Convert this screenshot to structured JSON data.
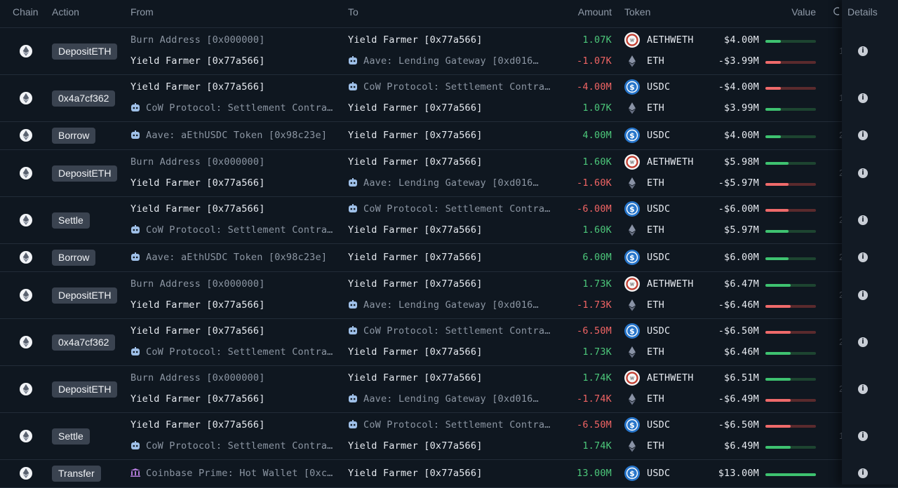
{
  "header": {
    "chain": "Chain",
    "action": "Action",
    "from": "From",
    "to": "To",
    "amount": "Amount",
    "token": "Token",
    "value": "Value",
    "details": "Details"
  },
  "colors": {
    "positive": "#4cc77a",
    "negative": "#f06464",
    "badge": "#3a4350"
  },
  "icons": {
    "chain": "ethereum-icon",
    "bot": "robot-icon",
    "bank": "bank-icon",
    "info": "info-icon",
    "clock": "clock-icon",
    "tokens": {
      "AETHWETH": "aethweth-token-icon",
      "ETH": "eth-token-icon",
      "USDC": "usdc-token-icon"
    }
  },
  "rows": [
    {
      "action": "DepositETH",
      "time_cut": "1",
      "lines": [
        {
          "from": "Burn Address [0x000000]",
          "from_style": "muted",
          "to": "Yield Farmer [0x77a566]",
          "to_style": "bright",
          "amount": "1.07K",
          "sign": "pos",
          "token": "AETHWETH",
          "usd": "$4.00M",
          "bar": 0.3
        },
        {
          "from": "Yield Farmer [0x77a566]",
          "from_style": "bright",
          "to": "Aave: Lending Gateway [0xd016…",
          "to_style": "muted",
          "to_icon": "bot",
          "amount": "-1.07K",
          "sign": "neg",
          "token": "ETH",
          "usd": "-$3.99M",
          "bar": 0.3
        }
      ]
    },
    {
      "action": "0x4a7cf362",
      "time_cut": "1",
      "lines": [
        {
          "from": "Yield Farmer [0x77a566]",
          "from_style": "bright",
          "to": "CoW Protocol: Settlement Contra…",
          "to_style": "muted",
          "to_icon": "bot",
          "amount": "-4.00M",
          "sign": "neg",
          "token": "USDC",
          "usd": "-$4.00M",
          "bar": 0.3
        },
        {
          "from": "CoW Protocol: Settlement Contra…",
          "from_style": "muted",
          "from_icon": "bot",
          "to": "Yield Farmer [0x77a566]",
          "to_style": "bright",
          "amount": "1.07K",
          "sign": "pos",
          "token": "ETH",
          "usd": "$3.99M",
          "bar": 0.3
        }
      ]
    },
    {
      "action": "Borrow",
      "time_cut": "2",
      "lines": [
        {
          "from": "Aave: aEthUSDC Token [0x98c23e]",
          "from_style": "muted",
          "from_icon": "bot",
          "to": "Yield Farmer [0x77a566]",
          "to_style": "bright",
          "amount": "4.00M",
          "sign": "pos",
          "token": "USDC",
          "usd": "$4.00M",
          "bar": 0.3
        }
      ]
    },
    {
      "action": "DepositETH",
      "time_cut": "2",
      "lines": [
        {
          "from": "Burn Address [0x000000]",
          "from_style": "muted",
          "to": "Yield Farmer [0x77a566]",
          "to_style": "bright",
          "amount": "1.60K",
          "sign": "pos",
          "token": "AETHWETH",
          "usd": "$5.98M",
          "bar": 0.46
        },
        {
          "from": "Yield Farmer [0x77a566]",
          "from_style": "bright",
          "to": "Aave: Lending Gateway [0xd016…",
          "to_style": "muted",
          "to_icon": "bot",
          "amount": "-1.60K",
          "sign": "neg",
          "token": "ETH",
          "usd": "-$5.97M",
          "bar": 0.46
        }
      ]
    },
    {
      "action": "Settle",
      "time_cut": "2",
      "lines": [
        {
          "from": "Yield Farmer [0x77a566]",
          "from_style": "bright",
          "to": "CoW Protocol: Settlement Contra…",
          "to_style": "muted",
          "to_icon": "bot",
          "amount": "-6.00M",
          "sign": "neg",
          "token": "USDC",
          "usd": "-$6.00M",
          "bar": 0.46
        },
        {
          "from": "CoW Protocol: Settlement Contra…",
          "from_style": "muted",
          "from_icon": "bot",
          "to": "Yield Farmer [0x77a566]",
          "to_style": "bright",
          "amount": "1.60K",
          "sign": "pos",
          "token": "ETH",
          "usd": "$5.97M",
          "bar": 0.46
        }
      ]
    },
    {
      "action": "Borrow",
      "time_cut": "2",
      "lines": [
        {
          "from": "Aave: aEthUSDC Token [0x98c23e]",
          "from_style": "muted",
          "from_icon": "bot",
          "to": "Yield Farmer [0x77a566]",
          "to_style": "bright",
          "amount": "6.00M",
          "sign": "pos",
          "token": "USDC",
          "usd": "$6.00M",
          "bar": 0.46
        }
      ]
    },
    {
      "action": "DepositETH",
      "time_cut": "2",
      "lines": [
        {
          "from": "Burn Address [0x000000]",
          "from_style": "muted",
          "to": "Yield Farmer [0x77a566]",
          "to_style": "bright",
          "amount": "1.73K",
          "sign": "pos",
          "token": "AETHWETH",
          "usd": "$6.47M",
          "bar": 0.5
        },
        {
          "from": "Yield Farmer [0x77a566]",
          "from_style": "bright",
          "to": "Aave: Lending Gateway [0xd016…",
          "to_style": "muted",
          "to_icon": "bot",
          "amount": "-1.73K",
          "sign": "neg",
          "token": "ETH",
          "usd": "-$6.46M",
          "bar": 0.5
        }
      ]
    },
    {
      "action": "0x4a7cf362",
      "time_cut": "2",
      "lines": [
        {
          "from": "Yield Farmer [0x77a566]",
          "from_style": "bright",
          "to": "CoW Protocol: Settlement Contra…",
          "to_style": "muted",
          "to_icon": "bot",
          "amount": "-6.50M",
          "sign": "neg",
          "token": "USDC",
          "usd": "-$6.50M",
          "bar": 0.5
        },
        {
          "from": "CoW Protocol: Settlement Contra…",
          "from_style": "muted",
          "from_icon": "bot",
          "to": "Yield Farmer [0x77a566]",
          "to_style": "bright",
          "amount": "1.73K",
          "sign": "pos",
          "token": "ETH",
          "usd": "$6.46M",
          "bar": 0.5
        }
      ]
    },
    {
      "action": "DepositETH",
      "time_cut": "2",
      "lines": [
        {
          "from": "Burn Address [0x000000]",
          "from_style": "muted",
          "to": "Yield Farmer [0x77a566]",
          "to_style": "bright",
          "amount": "1.74K",
          "sign": "pos",
          "token": "AETHWETH",
          "usd": "$6.51M",
          "bar": 0.5
        },
        {
          "from": "Yield Farmer [0x77a566]",
          "from_style": "bright",
          "to": "Aave: Lending Gateway [0xd016…",
          "to_style": "muted",
          "to_icon": "bot",
          "amount": "-1.74K",
          "sign": "neg",
          "token": "ETH",
          "usd": "-$6.49M",
          "bar": 0.5
        }
      ]
    },
    {
      "action": "Settle",
      "time_cut": "1",
      "lines": [
        {
          "from": "Yield Farmer [0x77a566]",
          "from_style": "bright",
          "to": "CoW Protocol: Settlement Contra…",
          "to_style": "muted",
          "to_icon": "bot",
          "amount": "-6.50M",
          "sign": "neg",
          "token": "USDC",
          "usd": "-$6.50M",
          "bar": 0.5
        },
        {
          "from": "CoW Protocol: Settlement Contra…",
          "from_style": "muted",
          "from_icon": "bot",
          "to": "Yield Farmer [0x77a566]",
          "to_style": "bright",
          "amount": "1.74K",
          "sign": "pos",
          "token": "ETH",
          "usd": "$6.49M",
          "bar": 0.5
        }
      ]
    },
    {
      "action": "Transfer",
      "time_cut": "",
      "lines": [
        {
          "from": "Coinbase Prime: Hot Wallet [0xc…",
          "from_style": "muted",
          "from_icon": "bank",
          "to": "Yield Farmer [0x77a566]",
          "to_style": "bright",
          "amount": "13.00M",
          "sign": "pos",
          "token": "USDC",
          "usd": "$13.00M",
          "bar": 1.0
        }
      ]
    }
  ]
}
